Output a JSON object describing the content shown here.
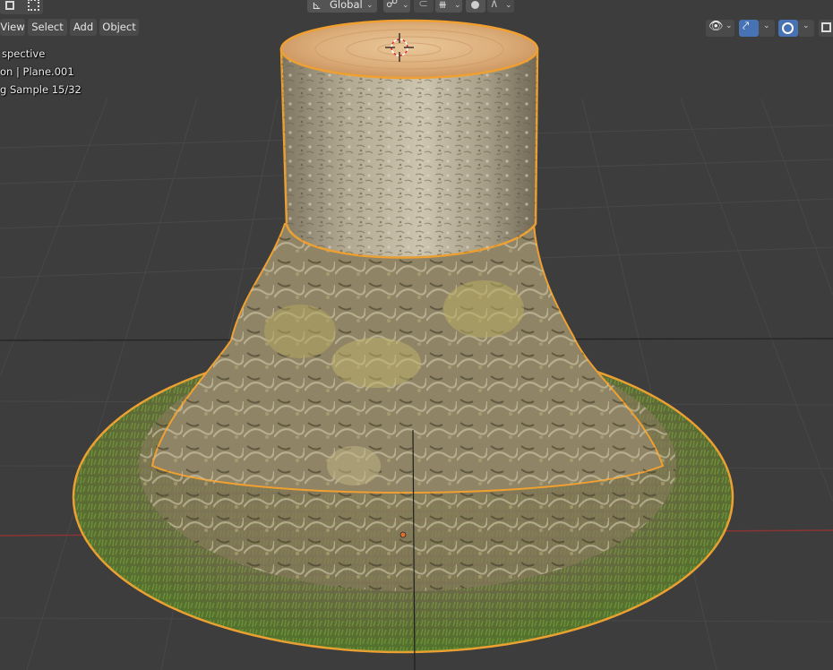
{
  "header": {
    "transform_orientation": "Global"
  },
  "menu": {
    "view": "View",
    "select": "Select",
    "add": "Add",
    "object": "Object"
  },
  "overlay": {
    "line1": "spective",
    "line2": "on | Plane.001",
    "line3": "g Sample 15/32"
  },
  "icons": {
    "orientation": "transform-orientation-icon",
    "pivot": "pivot-point-icon",
    "snap": "snap-magnet-icon",
    "snap_increment": "snap-increment-icon",
    "proportional": "proportional-editing-icon",
    "falloff": "falloff-curve-icon",
    "visibility": "eye-visibility-icon",
    "gizmo": "gizmo-icon",
    "overlays": "overlays-icon",
    "shading": "viewport-shading-icon",
    "cursor": "3d-cursor-icon",
    "origin": "object-origin-icon"
  },
  "colors": {
    "viewport_bg": "#3d3d3d",
    "grid": "#494949",
    "x_axis": "#8a3434",
    "selection_outline": "#f0a030",
    "header_button": "#545454",
    "active_toggle": "#4772b3"
  }
}
